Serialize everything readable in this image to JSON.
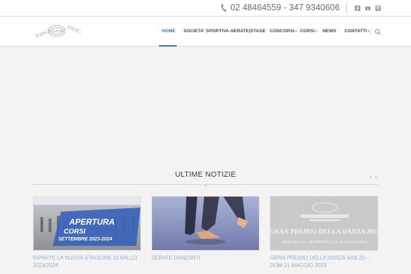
{
  "topbar": {
    "phone": "02 48464559 - 347 9340606",
    "social_icons": [
      "facebook-icon",
      "youtube-icon",
      "instagram-icon"
    ]
  },
  "header": {
    "logo_alt": "Dance Dance Dance",
    "nav": [
      {
        "label": "HOME",
        "active": true,
        "dropdown": false
      },
      {
        "label": "SOCIETA' SPORTIVA",
        "active": false,
        "dropdown": true
      },
      {
        "label": "SERATE|STAGE",
        "active": false,
        "dropdown": false
      },
      {
        "label": "CONCORSI",
        "active": false,
        "dropdown": true
      },
      {
        "label": "CORSI",
        "active": false,
        "dropdown": true
      },
      {
        "label": "NEWS",
        "active": false,
        "dropdown": false
      },
      {
        "label": "CONTATTI",
        "active": false,
        "dropdown": true
      }
    ],
    "search_icon": "search-icon"
  },
  "news": {
    "title": "ULTIME NOTIZIE",
    "prev": "‹",
    "next": "›",
    "cards": [
      {
        "title": "RIPARTE LA NUOVA STAGIONE DI BALLO 2023/2024",
        "image_text_1": "APERTURA",
        "image_text_2": "CORSI",
        "image_text_3": "SETTEMBRE 2023-2024"
      },
      {
        "title": "SERATE DANZANTI"
      },
      {
        "title": "GRAN PREMIO DELLA DANZA SAB 20 – DOM 21 MAGGIO 2023",
        "image_text_1": "GRAN PREMIO DELLA DANZA 2023",
        "image_text_2": "SABATO 20 - DOMENICA 21 MAGGIO 2023"
      }
    ]
  },
  "colors": {
    "accent": "#2f73b5",
    "link": "#8fb3d3"
  }
}
